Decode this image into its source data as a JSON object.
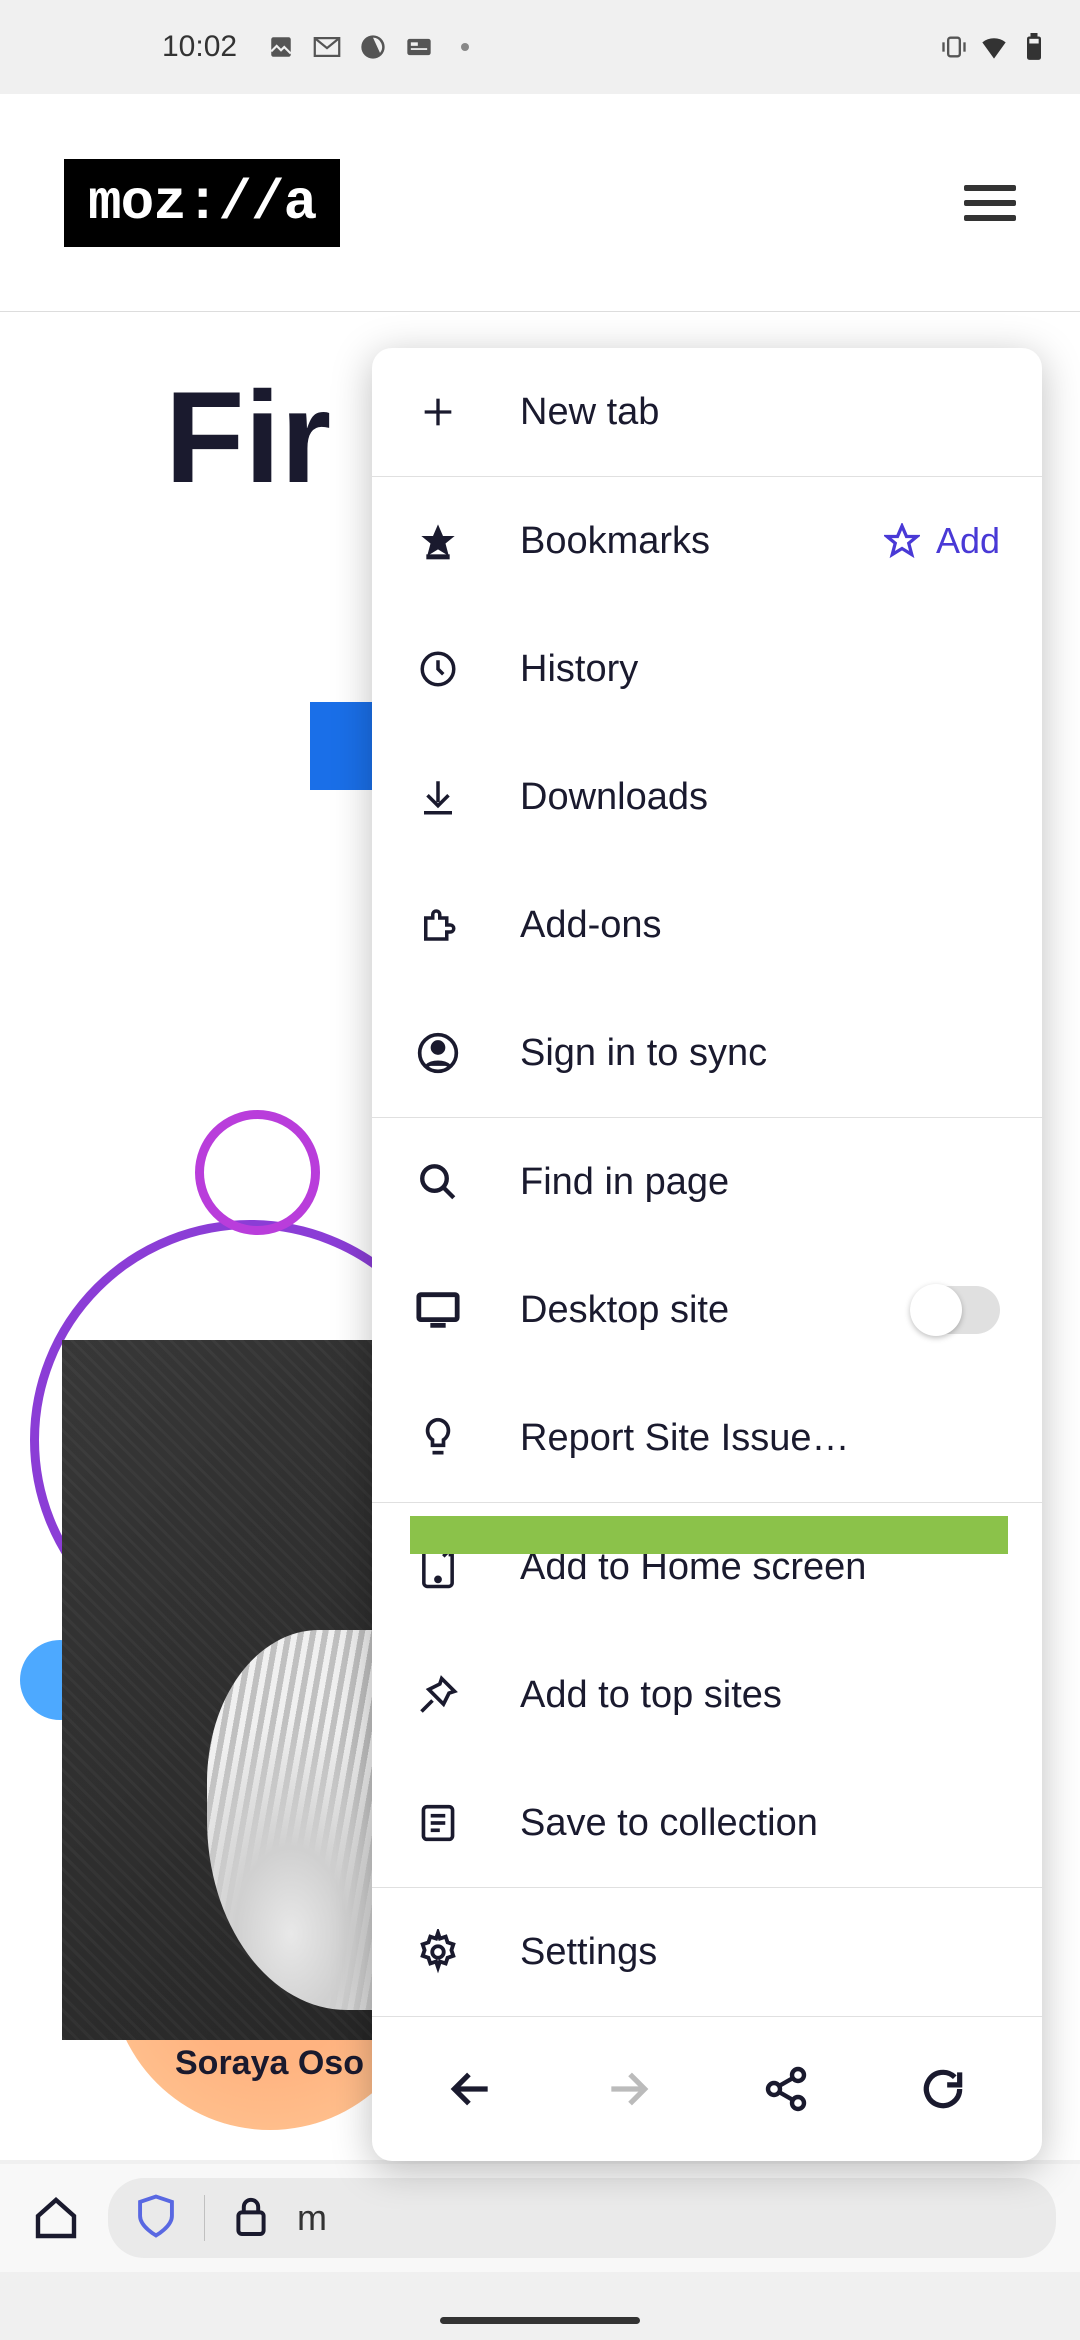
{
  "status": {
    "time": "10:02"
  },
  "header": {
    "logo_text": "moz://a"
  },
  "page": {
    "title_start": "Fir",
    "caption": "Soraya Oso"
  },
  "menu": {
    "new_tab": "New tab",
    "bookmarks": "Bookmarks",
    "add_label": "Add",
    "history": "History",
    "downloads": "Downloads",
    "addons": "Add-ons",
    "sync": "Sign in to sync",
    "find": "Find in page",
    "desktop": "Desktop site",
    "report": "Report Site Issue…",
    "add_home": "Add to Home screen",
    "add_top": "Add to top sites",
    "save_collection": "Save to collection",
    "settings": "Settings",
    "desktop_toggle": false
  },
  "urlbar": {
    "visible_text": "m"
  }
}
